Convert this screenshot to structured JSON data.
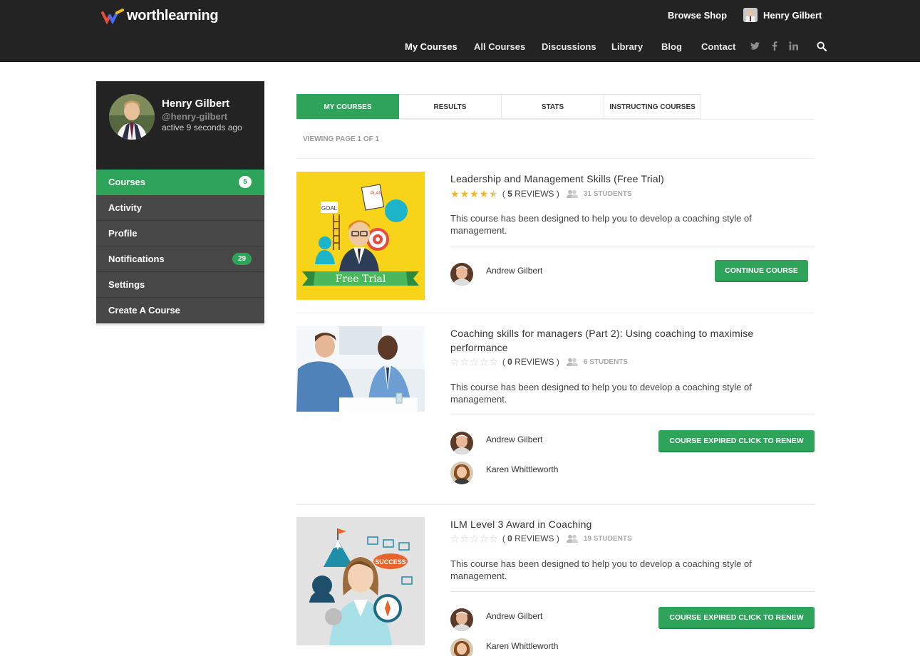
{
  "header": {
    "logo_text": "worthlearning",
    "browse_shop": "Browse Shop",
    "user_name": "Henry Gilbert",
    "nav": [
      "My Courses",
      "All Courses",
      "Discussions",
      "Library",
      "Blog",
      "Contact"
    ],
    "social": [
      "twitter-icon",
      "facebook-icon",
      "linkedin-icon"
    ],
    "search": "search-icon"
  },
  "profile": {
    "name": "Henry Gilbert",
    "handle": "@henry-gilbert",
    "activity": "active 9 seconds ago"
  },
  "sidebar": {
    "items": [
      {
        "label": "Courses",
        "badge": "5"
      },
      {
        "label": "Activity",
        "badge": ""
      },
      {
        "label": "Profile",
        "badge": ""
      },
      {
        "label": "Notifications",
        "badge": "29"
      },
      {
        "label": "Settings",
        "badge": ""
      },
      {
        "label": "Create A Course",
        "badge": ""
      }
    ]
  },
  "tabs": [
    "MY COURSES",
    "RESULTS",
    "STATS",
    "INSTRUCTING COURSES"
  ],
  "viewing": "VIEWING PAGE 1 OF 1",
  "courses": [
    {
      "title": "Leadership and Management Skills (Free Trial)",
      "reviews_open": "( ",
      "reviews_count": "5",
      "reviews_label": " REVIEWS )",
      "rating": 4.5,
      "students": "31 STUDENTS",
      "thumb_text_goal": "GOAL",
      "thumb_text_plan": "PLAN",
      "thumb_text_trial": "Free Trial",
      "description": "This course has been designed to help you to develop a coaching style of management.",
      "instructors": [
        "Andrew Gilbert"
      ],
      "button": "CONTINUE COURSE"
    },
    {
      "title": "Coaching skills for managers (Part 2): Using coaching to maximise performance",
      "reviews_open": "( ",
      "reviews_count": "0",
      "reviews_label": " REVIEWS )",
      "rating": 0,
      "students": "6 STUDENTS",
      "description": "This course has been designed to help you to develop a coaching style of management.",
      "instructors": [
        "Andrew Gilbert",
        "Karen Whittleworth"
      ],
      "button": "COURSE EXPIRED CLICK TO RENEW"
    },
    {
      "title": "ILM Level 3 Award in Coaching",
      "reviews_open": "( ",
      "reviews_count": "0",
      "reviews_label": " REVIEWS )",
      "rating": 0,
      "students": "19 STUDENTS",
      "thumb_text_success": "SUCCESS",
      "description": "This course has been designed to help you to develop a coaching style of management.",
      "instructors": [
        "Andrew Gilbert",
        "Karen Whittleworth"
      ],
      "button": "COURSE EXPIRED CLICK TO RENEW"
    }
  ],
  "colors": {
    "topbar": "#232323",
    "accent": "#2ea35a",
    "star": "#f6b819",
    "sidebar_item": "#474747"
  }
}
